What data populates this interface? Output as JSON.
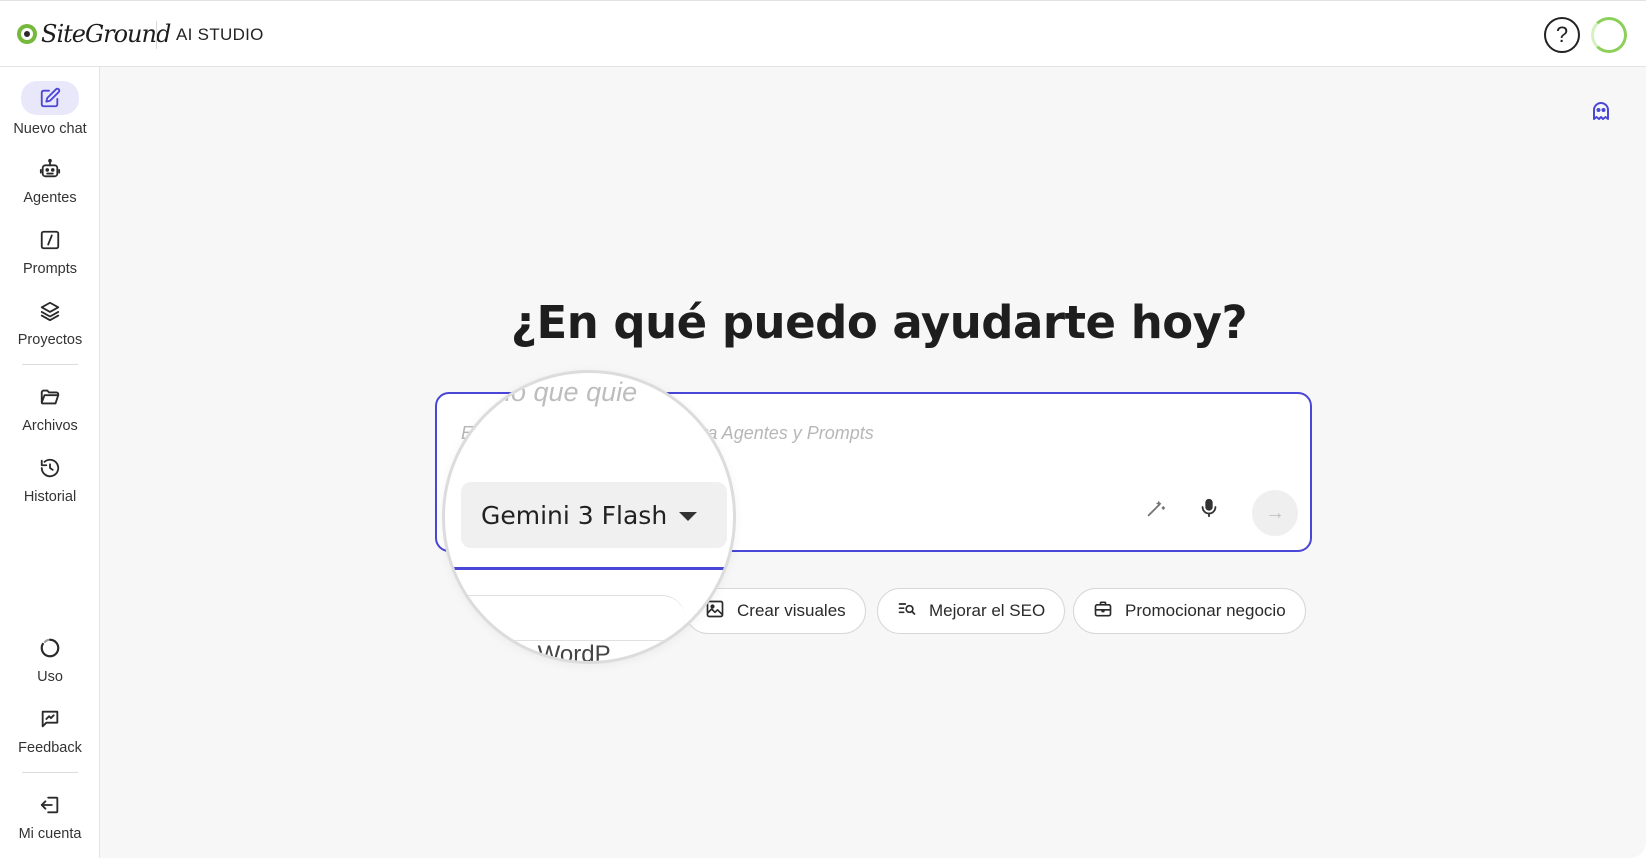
{
  "header": {
    "brand": "SiteGround",
    "product": "AI STUDIO",
    "help_label": "?"
  },
  "sidebar": {
    "items": [
      {
        "label": "Nuevo chat",
        "icon": "edit-icon",
        "active": true
      },
      {
        "label": "Agentes",
        "icon": "robot-icon"
      },
      {
        "label": "Prompts",
        "icon": "slash-square-icon"
      },
      {
        "label": "Proyectos",
        "icon": "layers-icon"
      },
      {
        "label": "Archivos",
        "icon": "folder-icon"
      },
      {
        "label": "Historial",
        "icon": "history-icon"
      }
    ],
    "bottom_items": [
      {
        "label": "Uso",
        "icon": "usage-ring-icon"
      },
      {
        "label": "Feedback",
        "icon": "feedback-icon"
      },
      {
        "label": "Mi cuenta",
        "icon": "sign-out-icon"
      }
    ]
  },
  "main": {
    "headline": "¿En qué puedo ayudarte hoy?",
    "prompt_placeholder": "E                                  a @ para Agentes y Prompts",
    "magnified_placeholder_fragment": "lo que quie",
    "model_selector": {
      "selected": "Gemini 3 Flash"
    },
    "magnified_chip_fragment": "r WordP",
    "send_symbol": "→",
    "suggestion_chips": [
      {
        "label": "Crear visuales",
        "icon": "image-icon"
      },
      {
        "label": "Mejorar el SEO",
        "icon": "seo-search-icon"
      },
      {
        "label": "Promocionar negocio",
        "icon": "briefcase-icon"
      }
    ]
  },
  "colors": {
    "accent": "#4a46d6",
    "active_nav_bg": "#e9e8fb",
    "brand_green": "#75b83b",
    "text": "#1e1e1e",
    "background": "#f7f7f7"
  }
}
